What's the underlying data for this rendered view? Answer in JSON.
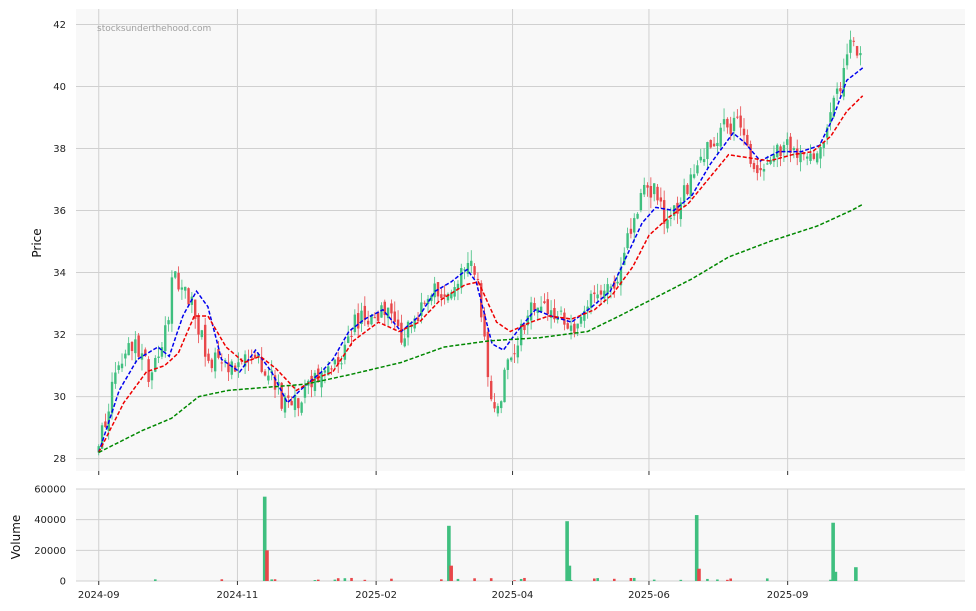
{
  "chart_data": {
    "type": "candlestick",
    "watermark": "stocksunderthehood.com",
    "colors": {
      "up": "#3fbf7f",
      "down": "#e8474a",
      "ma_fast": "#0000ee",
      "ma_mid": "#ee0000",
      "ma_slow": "#008800",
      "panel_bg": "#f8f8f8",
      "grid": "#d0d0d0"
    },
    "price_panel": {
      "ylabel": "Price",
      "ylim": [
        27.6,
        42.5
      ],
      "yticks": [
        "28",
        "30",
        "32",
        "34",
        "36",
        "38",
        "40",
        "42"
      ],
      "grid": true
    },
    "volume_panel": {
      "ylabel": "Volume",
      "ylim": [
        0,
        60000
      ],
      "yticks": [
        "0",
        "20000",
        "40000",
        "60000"
      ],
      "grid": true
    },
    "x_axis": {
      "type": "date",
      "xlim": [
        "2024-08-22",
        "2025-09-17"
      ],
      "ticks": [
        {
          "date": "2024-09-01",
          "label": "2024-09"
        },
        {
          "date": "2024-11-01",
          "label": "2024-11"
        },
        {
          "date": "2025-01-01",
          "label": "2025-02"
        },
        {
          "date": "2025-03-02",
          "label": "2025-04"
        },
        {
          "date": "2025-05-01",
          "label": "2025-06"
        },
        {
          "date": "2025-07-01",
          "label": "2025-09"
        }
      ]
    },
    "close_anchors": [
      [
        "2024-09-01",
        28.3
      ],
      [
        "2024-09-05",
        29.6
      ],
      [
        "2024-09-09",
        30.8
      ],
      [
        "2024-09-14",
        31.4
      ],
      [
        "2024-09-19",
        31.6
      ],
      [
        "2024-09-24",
        30.6
      ],
      [
        "2024-09-29",
        31.4
      ],
      [
        "2024-10-04",
        34.0
      ],
      [
        "2024-10-09",
        33.5
      ],
      [
        "2024-10-14",
        32.5
      ],
      [
        "2024-10-19",
        31.3
      ],
      [
        "2024-10-24",
        31.0
      ],
      [
        "2024-10-29",
        30.8
      ],
      [
        "2024-11-03",
        31.0
      ],
      [
        "2024-11-08",
        31.6
      ],
      [
        "2024-11-13",
        30.9
      ],
      [
        "2024-11-18",
        30.3
      ],
      [
        "2024-11-23",
        29.6
      ],
      [
        "2024-11-28",
        29.8
      ],
      [
        "2024-12-03",
        30.4
      ],
      [
        "2024-12-08",
        30.8
      ],
      [
        "2024-12-13",
        30.9
      ],
      [
        "2024-12-18",
        31.4
      ],
      [
        "2024-12-23",
        32.4
      ],
      [
        "2024-12-28",
        32.6
      ],
      [
        "2025-01-02",
        32.7
      ],
      [
        "2025-01-07",
        32.9
      ],
      [
        "2025-01-12",
        32.0
      ],
      [
        "2025-01-17",
        32.3
      ],
      [
        "2025-01-22",
        32.8
      ],
      [
        "2025-01-27",
        33.4
      ],
      [
        "2025-02-01",
        33.6
      ],
      [
        "2025-02-06",
        33.8
      ],
      [
        "2025-02-11",
        34.2
      ],
      [
        "2025-02-15",
        33.5
      ],
      [
        "2025-02-20",
        30.0
      ],
      [
        "2025-02-23",
        29.4
      ],
      [
        "2025-02-28",
        31.2
      ],
      [
        "2025-03-05",
        32.0
      ],
      [
        "2025-03-10",
        32.7
      ],
      [
        "2025-03-15",
        32.9
      ],
      [
        "2025-03-20",
        32.4
      ],
      [
        "2025-03-25",
        32.6
      ],
      [
        "2025-03-30",
        32.3
      ],
      [
        "2025-04-04",
        32.9
      ],
      [
        "2025-04-09",
        33.2
      ],
      [
        "2025-04-14",
        33.4
      ],
      [
        "2025-04-19",
        34.4
      ],
      [
        "2025-04-24",
        35.8
      ],
      [
        "2025-04-29",
        36.5
      ],
      [
        "2025-05-04",
        36.8
      ],
      [
        "2025-05-09",
        35.6
      ],
      [
        "2025-05-14",
        36.3
      ],
      [
        "2025-05-19",
        36.8
      ],
      [
        "2025-05-24",
        37.6
      ],
      [
        "2025-05-29",
        38.1
      ],
      [
        "2025-06-03",
        38.6
      ],
      [
        "2025-06-08",
        38.9
      ],
      [
        "2025-06-13",
        38.0
      ],
      [
        "2025-06-18",
        36.8
      ],
      [
        "2025-06-23",
        37.7
      ],
      [
        "2025-06-28",
        38.1
      ],
      [
        "2025-07-03",
        38.0
      ],
      [
        "2025-07-08",
        37.7
      ],
      [
        "2025-07-13",
        37.9
      ],
      [
        "2025-07-18",
        38.6
      ],
      [
        "2025-07-23",
        39.7
      ],
      [
        "2025-07-28",
        41.2
      ],
      [
        "2025-08-02",
        41.1
      ]
    ],
    "series": [
      {
        "key": "ma_fast",
        "anchors": [
          [
            "2024-09-01",
            28.2
          ],
          [
            "2024-09-10",
            30.2
          ],
          [
            "2024-09-18",
            31.2
          ],
          [
            "2024-09-27",
            31.6
          ],
          [
            "2024-10-02",
            31.3
          ],
          [
            "2024-10-08",
            32.6
          ],
          [
            "2024-10-14",
            33.4
          ],
          [
            "2024-10-19",
            32.9
          ],
          [
            "2024-10-25",
            31.2
          ],
          [
            "2024-11-02",
            30.8
          ],
          [
            "2024-11-09",
            31.5
          ],
          [
            "2024-11-16",
            30.8
          ],
          [
            "2024-11-23",
            29.8
          ],
          [
            "2024-11-30",
            30.3
          ],
          [
            "2024-12-08",
            30.8
          ],
          [
            "2024-12-13",
            31.2
          ],
          [
            "2024-12-20",
            32.1
          ],
          [
            "2024-12-27",
            32.5
          ],
          [
            "2025-01-04",
            32.8
          ],
          [
            "2025-01-12",
            32.1
          ],
          [
            "2025-01-20",
            32.6
          ],
          [
            "2025-01-27",
            33.4
          ],
          [
            "2025-02-03",
            33.7
          ],
          [
            "2025-02-10",
            34.1
          ],
          [
            "2025-02-14",
            33.7
          ],
          [
            "2025-02-21",
            31.7
          ],
          [
            "2025-02-26",
            31.5
          ],
          [
            "2025-03-04",
            32.1
          ],
          [
            "2025-03-12",
            32.8
          ],
          [
            "2025-03-19",
            32.6
          ],
          [
            "2025-03-28",
            32.4
          ],
          [
            "2025-04-06",
            32.9
          ],
          [
            "2025-04-14",
            33.4
          ],
          [
            "2025-04-21",
            34.5
          ],
          [
            "2025-04-28",
            35.6
          ],
          [
            "2025-05-04",
            36.1
          ],
          [
            "2025-05-12",
            36.0
          ],
          [
            "2025-05-20",
            36.5
          ],
          [
            "2025-05-28",
            37.5
          ],
          [
            "2025-06-07",
            38.5
          ],
          [
            "2025-06-12",
            38.2
          ],
          [
            "2025-06-19",
            37.6
          ],
          [
            "2025-06-27",
            37.9
          ],
          [
            "2025-07-07",
            37.9
          ],
          [
            "2025-07-15",
            38.1
          ],
          [
            "2025-07-21",
            39.0
          ],
          [
            "2025-07-27",
            40.2
          ],
          [
            "2025-08-03",
            40.6
          ]
        ]
      },
      {
        "key": "ma_mid",
        "anchors": [
          [
            "2024-09-01",
            28.2
          ],
          [
            "2024-09-12",
            29.8
          ],
          [
            "2024-09-22",
            30.8
          ],
          [
            "2024-09-30",
            31.0
          ],
          [
            "2024-10-06",
            31.4
          ],
          [
            "2024-10-13",
            32.6
          ],
          [
            "2024-10-19",
            32.6
          ],
          [
            "2024-10-27",
            31.6
          ],
          [
            "2024-11-04",
            31.1
          ],
          [
            "2024-11-11",
            31.3
          ],
          [
            "2024-11-18",
            30.9
          ],
          [
            "2024-11-27",
            30.2
          ],
          [
            "2024-12-06",
            30.6
          ],
          [
            "2024-12-13",
            30.8
          ],
          [
            "2024-12-22",
            31.8
          ],
          [
            "2025-01-02",
            32.4
          ],
          [
            "2025-01-11",
            32.1
          ],
          [
            "2025-01-20",
            32.4
          ],
          [
            "2025-01-29",
            33.1
          ],
          [
            "2025-02-09",
            33.6
          ],
          [
            "2025-02-15",
            33.7
          ],
          [
            "2025-02-23",
            32.4
          ],
          [
            "2025-03-01",
            32.1
          ],
          [
            "2025-03-10",
            32.4
          ],
          [
            "2025-03-18",
            32.6
          ],
          [
            "2025-03-28",
            32.5
          ],
          [
            "2025-04-07",
            32.8
          ],
          [
            "2025-04-15",
            33.3
          ],
          [
            "2025-04-24",
            34.2
          ],
          [
            "2025-05-01",
            35.2
          ],
          [
            "2025-05-10",
            35.8
          ],
          [
            "2025-05-18",
            36.2
          ],
          [
            "2025-05-27",
            37.0
          ],
          [
            "2025-06-05",
            37.8
          ],
          [
            "2025-06-14",
            37.7
          ],
          [
            "2025-06-23",
            37.6
          ],
          [
            "2025-07-03",
            37.8
          ],
          [
            "2025-07-12",
            37.9
          ],
          [
            "2025-07-20",
            38.4
          ],
          [
            "2025-07-27",
            39.2
          ],
          [
            "2025-08-03",
            39.7
          ]
        ]
      },
      {
        "key": "ma_slow",
        "anchors": [
          [
            "2024-09-01",
            28.2
          ],
          [
            "2024-09-20",
            28.9
          ],
          [
            "2024-10-03",
            29.3
          ],
          [
            "2024-10-15",
            30.0
          ],
          [
            "2024-10-28",
            30.2
          ],
          [
            "2024-11-14",
            30.3
          ],
          [
            "2024-12-01",
            30.4
          ],
          [
            "2024-12-20",
            30.7
          ],
          [
            "2025-01-12",
            31.1
          ],
          [
            "2025-01-31",
            31.6
          ],
          [
            "2025-02-20",
            31.8
          ],
          [
            "2025-03-14",
            31.9
          ],
          [
            "2025-04-04",
            32.1
          ],
          [
            "2025-04-18",
            32.6
          ],
          [
            "2025-05-04",
            33.2
          ],
          [
            "2025-05-20",
            33.8
          ],
          [
            "2025-06-05",
            34.5
          ],
          [
            "2025-06-23",
            35.0
          ],
          [
            "2025-07-14",
            35.5
          ],
          [
            "2025-07-29",
            36.0
          ],
          [
            "2025-08-03",
            36.2
          ]
        ]
      }
    ],
    "volume_spikes": [
      [
        "2024-11-13",
        55000,
        "up"
      ],
      [
        "2024-11-14",
        20000,
        "down"
      ],
      [
        "2025-02-02",
        36000,
        "up"
      ],
      [
        "2025-02-03",
        10000,
        "down"
      ],
      [
        "2025-03-26",
        39000,
        "up"
      ],
      [
        "2025-03-27",
        10000,
        "up"
      ],
      [
        "2025-05-22",
        43000,
        "up"
      ],
      [
        "2025-05-23",
        8000,
        "down"
      ],
      [
        "2025-07-21",
        38000,
        "up"
      ],
      [
        "2025-07-22",
        6000,
        "up"
      ],
      [
        "2025-07-31",
        9000,
        "up"
      ]
    ],
    "candle_count": 230
  }
}
